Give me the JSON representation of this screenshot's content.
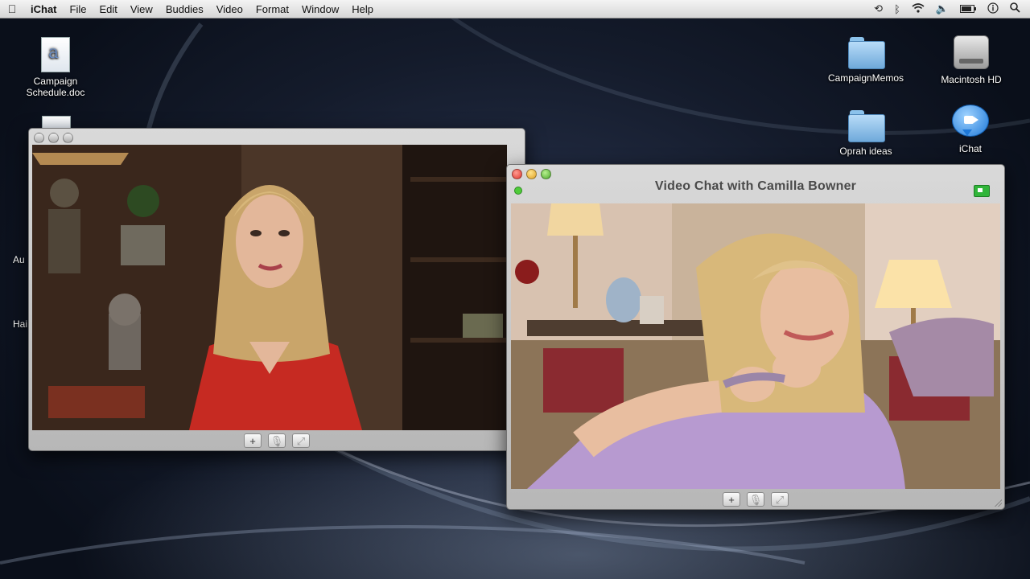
{
  "menubar": {
    "app": "iChat",
    "items": [
      "File",
      "Edit",
      "View",
      "Buddies",
      "Video",
      "Format",
      "Window",
      "Help"
    ]
  },
  "desktop": {
    "left_icons": [
      {
        "label": "Campaign Schedule.doc",
        "icon": "word-doc-icon"
      }
    ],
    "partial_labels": [
      "Au",
      "Hai"
    ],
    "right_icons": [
      {
        "label": "CampaignMemos",
        "icon": "folder-icon"
      },
      {
        "label": "Macintosh HD",
        "icon": "hard-drive-icon"
      },
      {
        "label": "Oprah ideas",
        "icon": "folder-icon"
      },
      {
        "label": "iChat",
        "icon": "ichat-icon"
      }
    ]
  },
  "windows": {
    "preview": {
      "toolbar": [
        "+",
        "mic-icon",
        "fullscreen-icon"
      ]
    },
    "chat": {
      "title": "Video Chat with Camilla Bowner",
      "toolbar": [
        "+",
        "mic-icon",
        "fullscreen-icon"
      ]
    }
  },
  "colors": {
    "accent_green": "#31b53a",
    "close_red": "#e0362d",
    "minimize_yellow": "#dea024",
    "zoom_green": "#4da82c"
  }
}
